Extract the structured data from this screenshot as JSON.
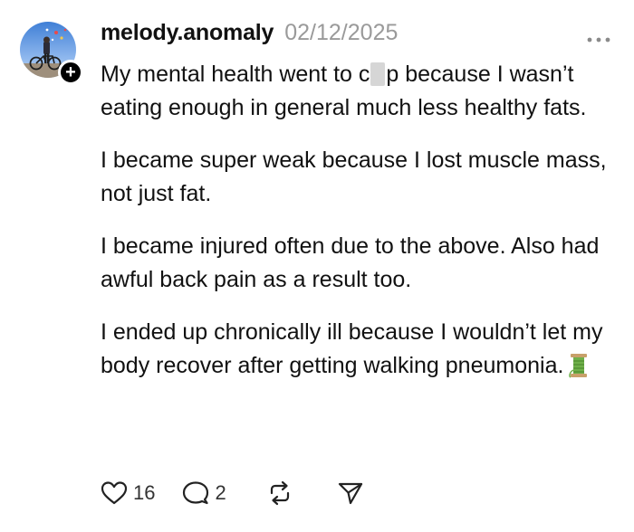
{
  "post": {
    "author": "melody.anomaly",
    "date": "02/12/2025",
    "paragraphs": [
      {
        "before": "My mental health went to c",
        "after": "p because I wasn’t eating enough in general much less healthy fats."
      },
      {
        "text": "I became super weak because I lost muscle mass, not just fat."
      },
      {
        "text": "I became injured often due to the above. Also had awful back pain as a result too."
      },
      {
        "text": "I ended up chronically ill because I wouldn’t let my body recover after getting walking pneumonia."
      }
    ]
  },
  "actions": {
    "likes": "16",
    "replies": "2"
  },
  "icons": {
    "like": "heart-icon",
    "reply": "speech-bubble-icon",
    "repost": "repost-icon",
    "share": "send-icon",
    "more": "ellipsis-icon",
    "follow": "plus-icon",
    "emoji": "thread-spool-icon"
  },
  "colors": {
    "text": "#111111",
    "muted": "#9a9a9a",
    "background": "#ffffff"
  }
}
